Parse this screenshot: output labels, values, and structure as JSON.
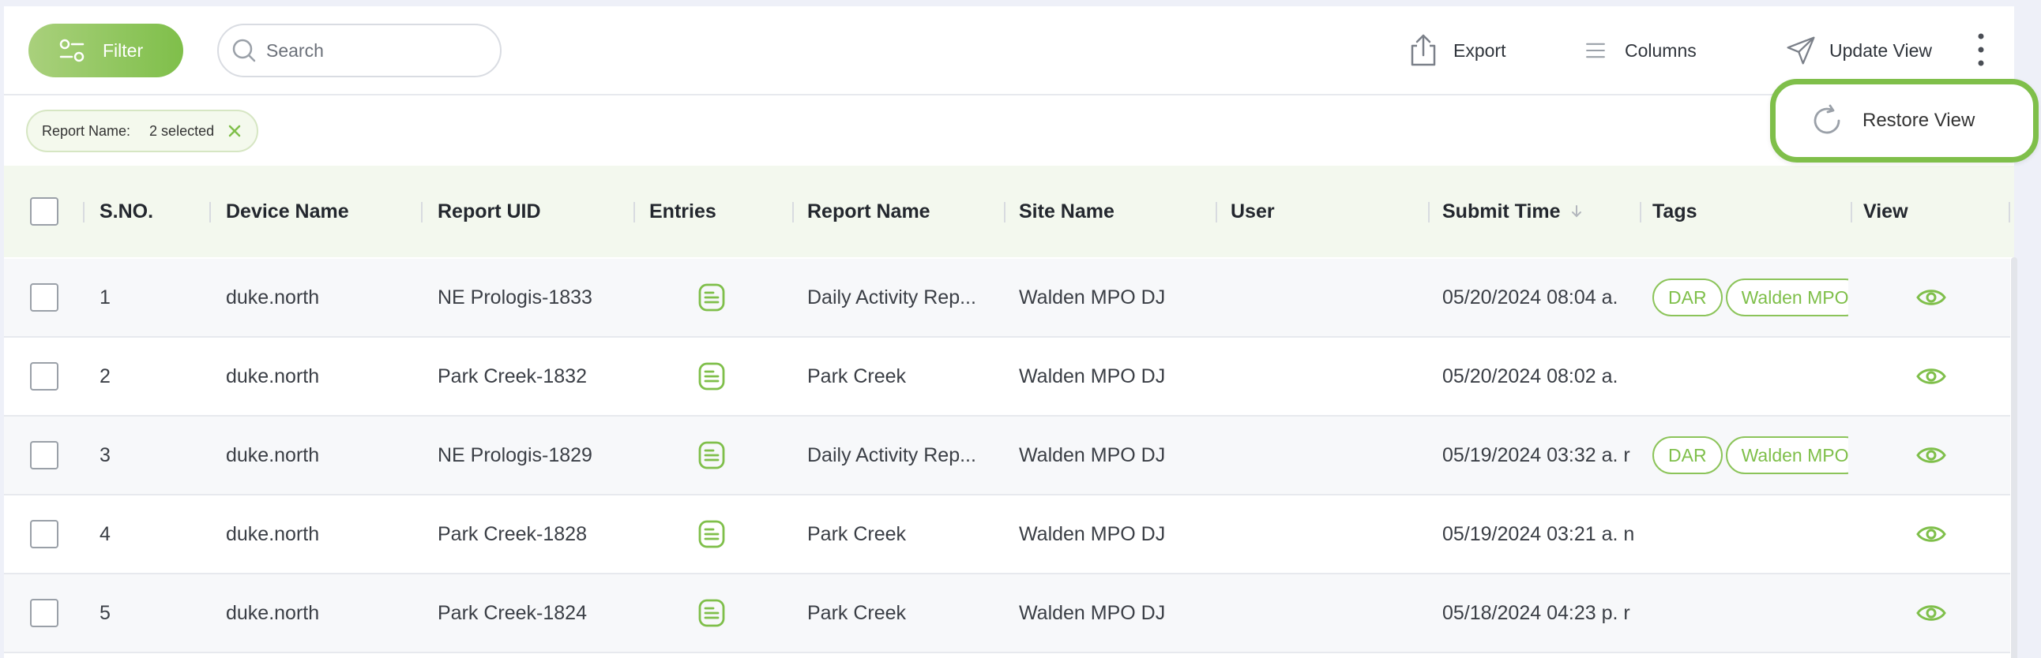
{
  "toolbar": {
    "filter_label": "Filter",
    "search_placeholder": "Search",
    "export_label": "Export",
    "columns_label": "Columns",
    "update_view_label": "Update View"
  },
  "filter_chip": {
    "label": "Report Name:",
    "value": "2 selected"
  },
  "popup": {
    "restore_view_label": "Restore View"
  },
  "table": {
    "columns": [
      "S.NO.",
      "Device Name",
      "Report UID",
      "Entries",
      "Report Name",
      "Site Name",
      "User",
      "Submit Time",
      "Tags",
      "View"
    ],
    "rows": [
      {
        "sno": "1",
        "device": "duke.north",
        "uid": "NE Prologis-1833",
        "report_name": "Daily Activity Rep...",
        "site": "Walden MPO DJ",
        "user": "",
        "submit_time": "05/20/2024 08:04 a.",
        "tags": [
          "DAR",
          "Walden MPO"
        ]
      },
      {
        "sno": "2",
        "device": "duke.north",
        "uid": "Park Creek-1832",
        "report_name": "Park Creek",
        "site": "Walden MPO DJ",
        "user": "",
        "submit_time": "05/20/2024 08:02 a.",
        "tags": []
      },
      {
        "sno": "3",
        "device": "duke.north",
        "uid": "NE Prologis-1829",
        "report_name": "Daily Activity Rep...",
        "site": "Walden MPO DJ",
        "user": "",
        "submit_time": "05/19/2024 03:32 a. r",
        "tags": [
          "DAR",
          "Walden MPO"
        ]
      },
      {
        "sno": "4",
        "device": "duke.north",
        "uid": "Park Creek-1828",
        "report_name": "Park Creek",
        "site": "Walden MPO DJ",
        "user": "",
        "submit_time": "05/19/2024 03:21 a. n",
        "tags": []
      },
      {
        "sno": "5",
        "device": "duke.north",
        "uid": "Park Creek-1824",
        "report_name": "Park Creek",
        "site": "Walden MPO DJ",
        "user": "",
        "submit_time": "05/18/2024 04:23 p. r",
        "tags": []
      }
    ]
  },
  "colors": {
    "accent": "#7fbf4a",
    "header_bg": "#f3f8ee"
  },
  "icons": {
    "filter": "sliders-icon",
    "search": "search-icon",
    "export": "share-upload-icon",
    "columns": "list-icon",
    "update_view": "send-icon",
    "menu": "kebab-icon",
    "restore": "refresh-icon",
    "entries": "document-icon",
    "view": "eye-icon",
    "sort": "arrow-down-icon",
    "close": "close-icon"
  }
}
